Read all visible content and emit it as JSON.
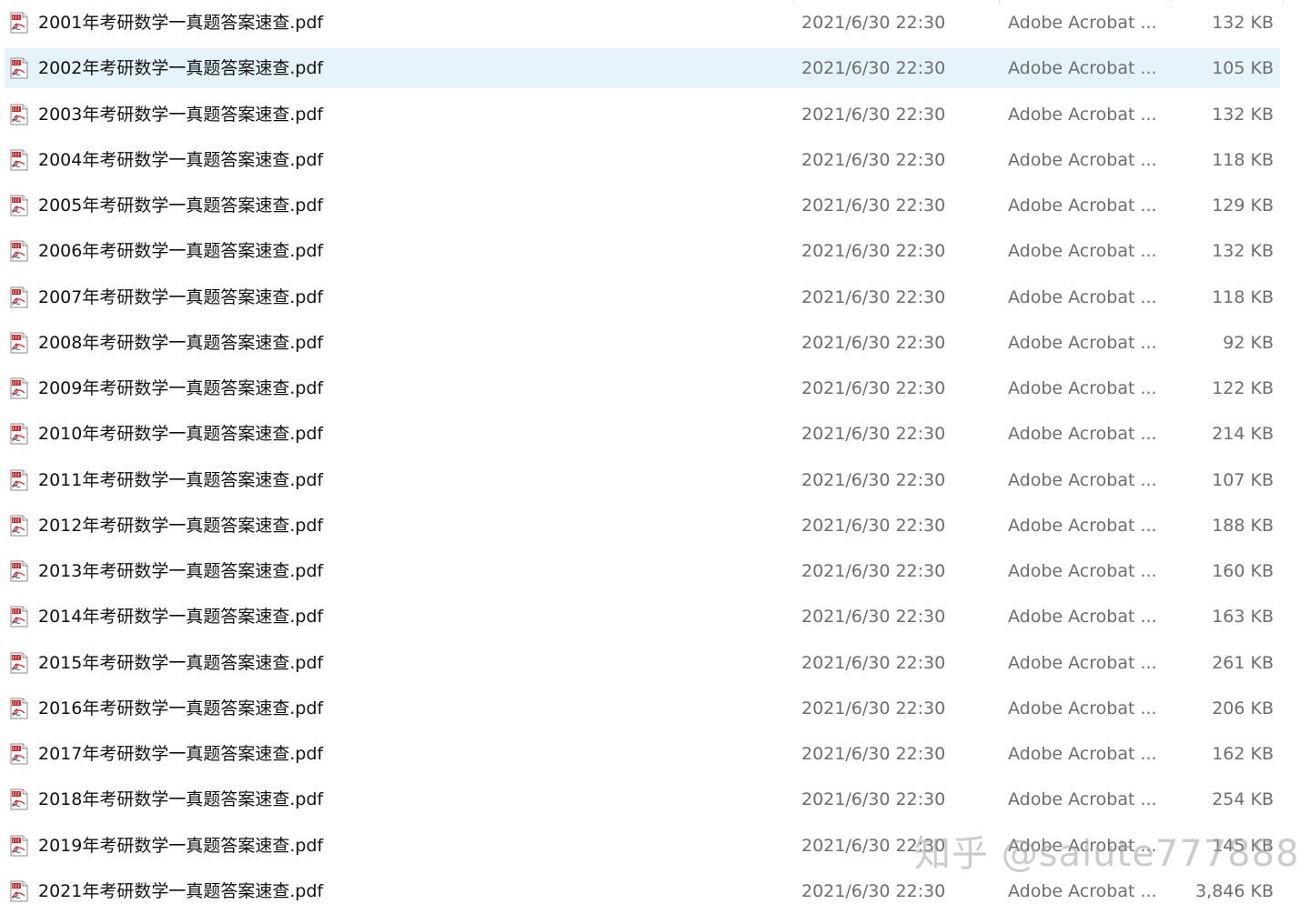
{
  "selected_row": 1,
  "files": [
    {
      "name": "2001年考研数学一真题答案速查.pdf",
      "modified": "2021/6/30 22:30",
      "type": "Adobe Acrobat ...",
      "size": "132 KB",
      "icon": "pdf-file-icon"
    },
    {
      "name": "2002年考研数学一真题答案速查.pdf",
      "modified": "2021/6/30 22:30",
      "type": "Adobe Acrobat ...",
      "size": "105 KB",
      "icon": "pdf-file-icon"
    },
    {
      "name": "2003年考研数学一真题答案速查.pdf",
      "modified": "2021/6/30 22:30",
      "type": "Adobe Acrobat ...",
      "size": "132 KB",
      "icon": "pdf-file-icon"
    },
    {
      "name": "2004年考研数学一真题答案速查.pdf",
      "modified": "2021/6/30 22:30",
      "type": "Adobe Acrobat ...",
      "size": "118 KB",
      "icon": "pdf-file-icon"
    },
    {
      "name": "2005年考研数学一真题答案速查.pdf",
      "modified": "2021/6/30 22:30",
      "type": "Adobe Acrobat ...",
      "size": "129 KB",
      "icon": "pdf-file-icon"
    },
    {
      "name": "2006年考研数学一真题答案速查.pdf",
      "modified": "2021/6/30 22:30",
      "type": "Adobe Acrobat ...",
      "size": "132 KB",
      "icon": "pdf-file-icon"
    },
    {
      "name": "2007年考研数学一真题答案速查.pdf",
      "modified": "2021/6/30 22:30",
      "type": "Adobe Acrobat ...",
      "size": "118 KB",
      "icon": "pdf-file-icon"
    },
    {
      "name": "2008年考研数学一真题答案速查.pdf",
      "modified": "2021/6/30 22:30",
      "type": "Adobe Acrobat ...",
      "size": "92 KB",
      "icon": "pdf-file-icon"
    },
    {
      "name": "2009年考研数学一真题答案速查.pdf",
      "modified": "2021/6/30 22:30",
      "type": "Adobe Acrobat ...",
      "size": "122 KB",
      "icon": "pdf-file-icon"
    },
    {
      "name": "2010年考研数学一真题答案速查.pdf",
      "modified": "2021/6/30 22:30",
      "type": "Adobe Acrobat ...",
      "size": "214 KB",
      "icon": "pdf-file-icon"
    },
    {
      "name": "2011年考研数学一真题答案速查.pdf",
      "modified": "2021/6/30 22:30",
      "type": "Adobe Acrobat ...",
      "size": "107 KB",
      "icon": "pdf-file-icon"
    },
    {
      "name": "2012年考研数学一真题答案速查.pdf",
      "modified": "2021/6/30 22:30",
      "type": "Adobe Acrobat ...",
      "size": "188 KB",
      "icon": "pdf-file-icon"
    },
    {
      "name": "2013年考研数学一真题答案速查.pdf",
      "modified": "2021/6/30 22:30",
      "type": "Adobe Acrobat ...",
      "size": "160 KB",
      "icon": "pdf-file-icon"
    },
    {
      "name": "2014年考研数学一真题答案速查.pdf",
      "modified": "2021/6/30 22:30",
      "type": "Adobe Acrobat ...",
      "size": "163 KB",
      "icon": "pdf-file-icon"
    },
    {
      "name": "2015年考研数学一真题答案速查.pdf",
      "modified": "2021/6/30 22:30",
      "type": "Adobe Acrobat ...",
      "size": "261 KB",
      "icon": "pdf-file-icon"
    },
    {
      "name": "2016年考研数学一真题答案速查.pdf",
      "modified": "2021/6/30 22:30",
      "type": "Adobe Acrobat ...",
      "size": "206 KB",
      "icon": "pdf-file-icon"
    },
    {
      "name": "2017年考研数学一真题答案速查.pdf",
      "modified": "2021/6/30 22:30",
      "type": "Adobe Acrobat ...",
      "size": "162 KB",
      "icon": "pdf-file-icon"
    },
    {
      "name": "2018年考研数学一真题答案速查.pdf",
      "modified": "2021/6/30 22:30",
      "type": "Adobe Acrobat ...",
      "size": "254 KB",
      "icon": "pdf-file-icon"
    },
    {
      "name": "2019年考研数学一真题答案速查.pdf",
      "modified": "2021/6/30 22:30",
      "type": "Adobe Acrobat ...",
      "size": "145 KB",
      "icon": "pdf-file-icon"
    },
    {
      "name": "2021年考研数学一真题答案速查.pdf",
      "modified": "2021/6/30 22:30",
      "type": "Adobe Acrobat ...",
      "size": "3,846 KB",
      "icon": "pdf-file-icon"
    }
  ],
  "watermark": "知乎 @salute777888",
  "colors": {
    "selected_row_bg": "#e5f3fb",
    "name_text": "#111111",
    "detail_text": "#6d6d6d",
    "pdf_red": "#d62828"
  }
}
